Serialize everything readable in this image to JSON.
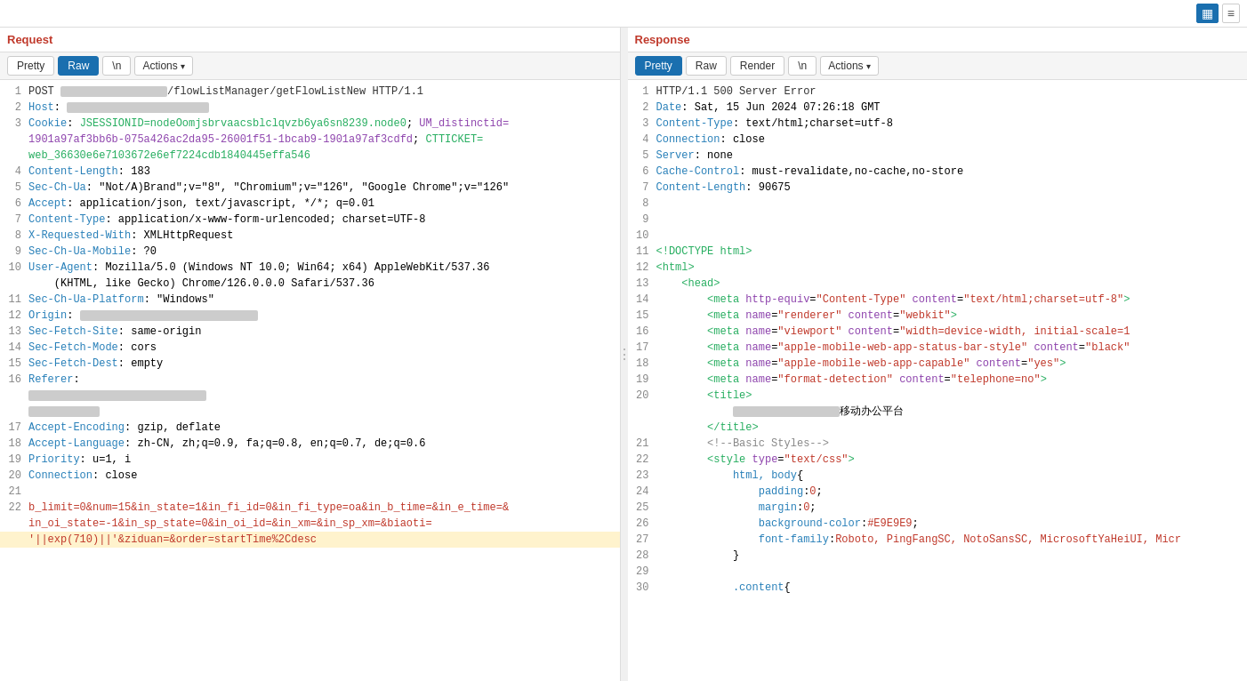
{
  "topbar": {
    "grid_icon": "▦",
    "list_icon": "≡"
  },
  "request": {
    "title": "Request",
    "tabs": [
      "Pretty",
      "Raw",
      "\\n",
      "Actions ▾"
    ],
    "active_tab": "Raw"
  },
  "response": {
    "title": "Response",
    "tabs": [
      "Pretty",
      "Raw",
      "Render",
      "\\n",
      "Actions ▾"
    ],
    "active_tab": "Pretty"
  }
}
